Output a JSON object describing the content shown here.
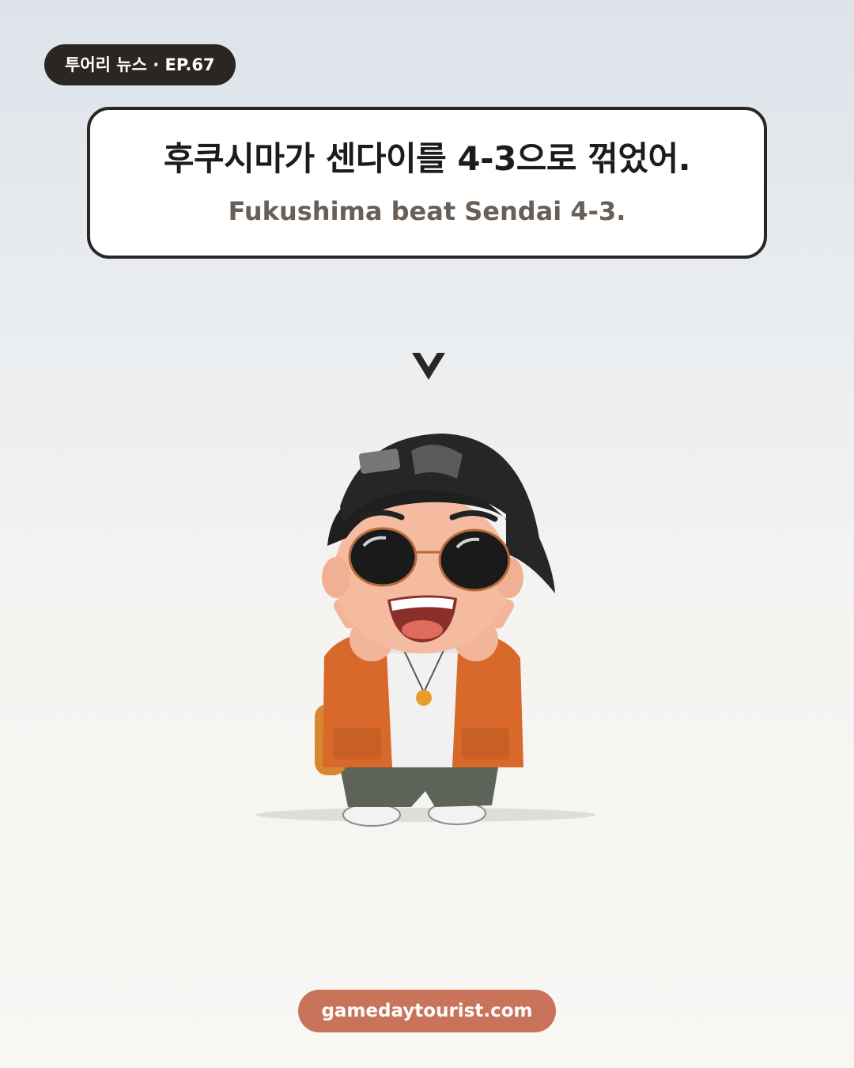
{
  "badge": {
    "label": "투어리 뉴스 · EP.67"
  },
  "headline": {
    "korean": "후쿠시마가 센다이를 4-3으로 꺾었어.",
    "english": "Fukushima beat Sendai 4-3."
  },
  "arrow_icon": "chevron-down-icon",
  "illustration": "mascot-character",
  "footer": {
    "url": "gamedaytourist.com"
  },
  "colors": {
    "badge_bg": "#2a2622",
    "card_border": "#2a2622",
    "english_text": "#6a5f56",
    "url_pill_bg": "#c9735a"
  }
}
